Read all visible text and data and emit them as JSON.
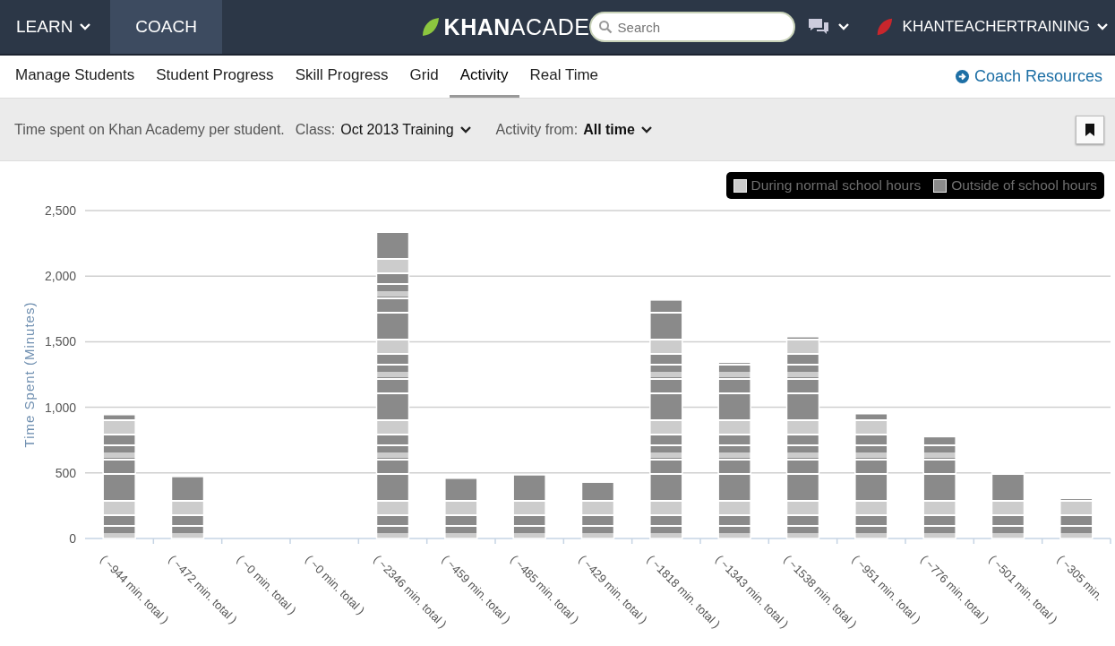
{
  "top_nav": {
    "items": [
      {
        "label": "LEARN",
        "dropdown": true,
        "selected": false
      },
      {
        "label": "COACH",
        "dropdown": false,
        "selected": true
      }
    ],
    "logo": "**KHAN**ACADE",
    "search": {
      "placeholder": "Search"
    },
    "user": "KHANTEACHERTRAINING"
  },
  "tabs": [
    {
      "label": "Manage Students",
      "selected": false
    },
    {
      "label": "Student Progress",
      "selected": false
    },
    {
      "label": "Skill Progress",
      "selected": false
    },
    {
      "label": "Grid",
      "selected": false
    },
    {
      "label": "Activity",
      "selected": true
    },
    {
      "label": "Real Time",
      "selected": false
    }
  ],
  "resources_link": "Coach Resources",
  "filter_bar": {
    "description": "Time spent on Khan Academy per student.",
    "class_label": "Class:",
    "class_value": "Oct 2013 Training",
    "range_label": "Activity from:",
    "range_value": "All time"
  },
  "chart": {
    "legend": [
      {
        "label": "During normal school hours",
        "color": "#cccccc"
      },
      {
        "label": "Outside of school hours",
        "color": "#8a8a8a"
      }
    ],
    "chart_data": {
      "type": "bar",
      "ylabel": "Time Spent (Minutes)",
      "categories": [
        "( ~944 min. total )",
        "( ~472 min. total )",
        "( ~0 min. total )",
        "( ~0 min. total )",
        "( ~2346 min. total )",
        "( ~459 min. total )",
        "( ~485 min. total )",
        "( ~429 min. total )",
        "( ~1818 min. total )",
        "( ~1343 min. total )",
        "( ~1538 min. total )",
        "( ~951 min. total )",
        "( ~776 min. total )",
        "( ~501 min. total )",
        "( ~305 min."
      ],
      "values": [
        944,
        472,
        0,
        0,
        2346,
        459,
        485,
        429,
        1818,
        1343,
        1538,
        951,
        776,
        501,
        305
      ],
      "ylim": [
        0,
        2500
      ],
      "grid": true,
      "yticks": [
        {
          "value": 0,
          "label": "0"
        },
        {
          "value": 500,
          "label": "500"
        },
        {
          "value": 1000,
          "label": "1,000"
        },
        {
          "value": 1500,
          "label": "1,500"
        },
        {
          "value": 2000,
          "label": "2,000"
        },
        {
          "value": 2500,
          "label": "2,500"
        }
      ]
    }
  }
}
